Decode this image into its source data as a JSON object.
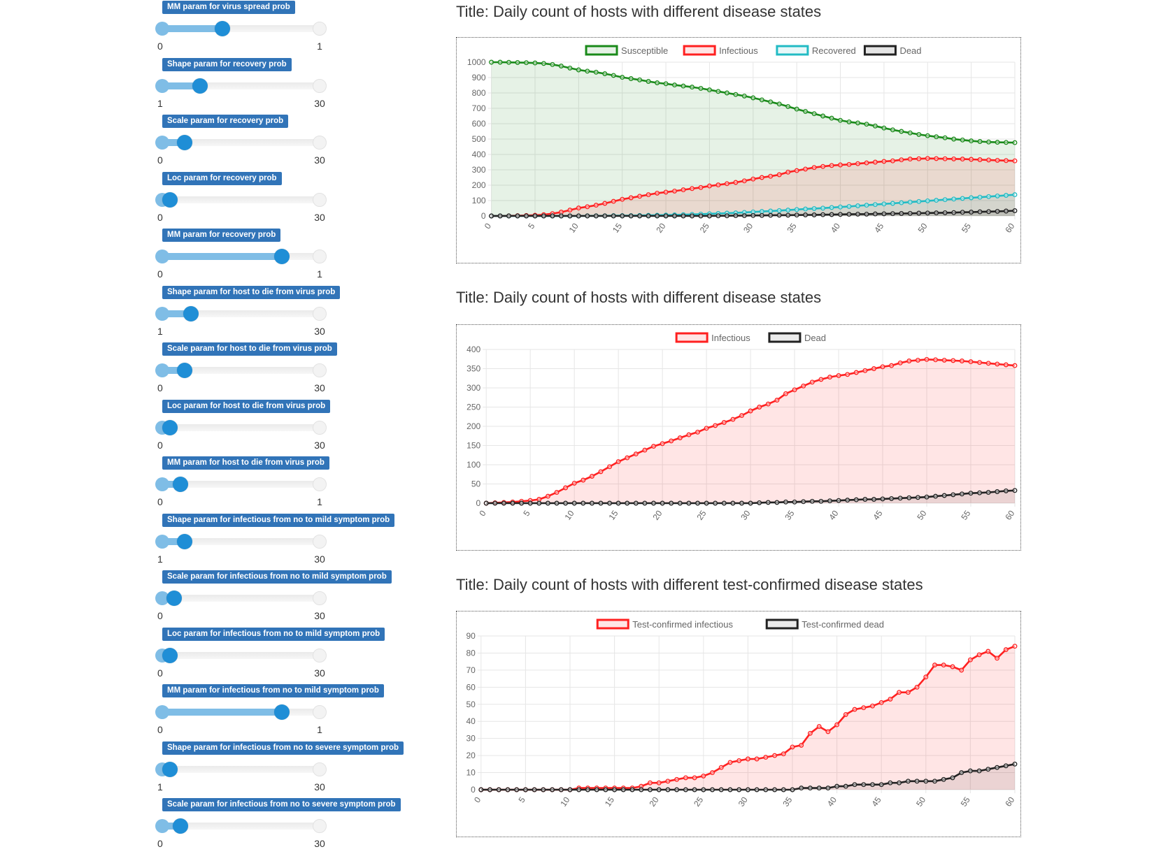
{
  "sliders": [
    {
      "label": "MM param for virus spread prob",
      "min": "0",
      "max": "1",
      "value": 0.35
    },
    {
      "label": "Shape param for recovery prob",
      "min": "1",
      "max": "30",
      "value": 0.2
    },
    {
      "label": "Scale param for recovery prob",
      "min": "0",
      "max": "30",
      "value": 0.1
    },
    {
      "label": "Loc param for recovery prob",
      "min": "0",
      "max": "30",
      "value": 0.0
    },
    {
      "label": "MM param for recovery prob",
      "min": "0",
      "max": "1",
      "value": 0.75
    },
    {
      "label": "Shape param for host to die from virus prob",
      "min": "1",
      "max": "30",
      "value": 0.14
    },
    {
      "label": "Scale param for host to die from virus prob",
      "min": "0",
      "max": "30",
      "value": 0.1
    },
    {
      "label": "Loc param for host to die from virus prob",
      "min": "0",
      "max": "30",
      "value": 0.0
    },
    {
      "label": "MM param for host to die from virus prob",
      "min": "0",
      "max": "1",
      "value": 0.07
    },
    {
      "label": "Shape param for infectious from no to mild symptom prob",
      "min": "1",
      "max": "30",
      "value": 0.1
    },
    {
      "label": "Scale param for infectious from no to mild symptom prob",
      "min": "0",
      "max": "30",
      "value": 0.03
    },
    {
      "label": "Loc param for infectious from no to mild symptom prob",
      "min": "0",
      "max": "30",
      "value": 0.0
    },
    {
      "label": "MM param for infectious from no to mild symptom prob",
      "min": "0",
      "max": "1",
      "value": 0.75
    },
    {
      "label": "Shape param for infectious from no to severe symptom prob",
      "min": "1",
      "max": "30",
      "value": 0.0
    },
    {
      "label": "Scale param for infectious from no to severe symptom prob",
      "min": "0",
      "max": "30",
      "value": 0.07
    }
  ],
  "colors": {
    "accent": "#1f8ed6",
    "label_bg": "#3174b8",
    "green": "#1a8a1a",
    "red": "#ff2020",
    "cyan": "#22bbc4",
    "black": "#222222"
  },
  "chart_data": [
    {
      "type": "area",
      "title": "Title: Daily count of hosts with different disease states",
      "x": [
        0,
        1,
        2,
        3,
        4,
        5,
        6,
        7,
        8,
        9,
        10,
        11,
        12,
        13,
        14,
        15,
        16,
        17,
        18,
        19,
        20,
        21,
        22,
        23,
        24,
        25,
        26,
        27,
        28,
        29,
        30,
        31,
        32,
        33,
        34,
        35,
        36,
        37,
        38,
        39,
        40,
        41,
        42,
        43,
        44,
        45,
        46,
        47,
        48,
        49,
        50,
        51,
        52,
        53,
        54,
        55,
        56,
        57,
        58,
        59,
        60
      ],
      "xticks": [
        0,
        5,
        10,
        15,
        20,
        25,
        30,
        35,
        40,
        45,
        50,
        55,
        60
      ],
      "ylim": [
        0,
        1000
      ],
      "yticks": [
        0,
        100,
        200,
        300,
        400,
        500,
        600,
        700,
        800,
        900,
        1000
      ],
      "legend_position": "top-center",
      "series": [
        {
          "name": "Susceptible",
          "color": "#1a8a1a",
          "fill": "rgba(26,138,26,0.11)",
          "values": [
            1000,
            1000,
            999,
            998,
            997,
            995,
            992,
            985,
            975,
            962,
            950,
            942,
            935,
            925,
            914,
            902,
            893,
            885,
            875,
            866,
            860,
            852,
            845,
            838,
            830,
            820,
            810,
            800,
            790,
            780,
            768,
            755,
            742,
            728,
            712,
            695,
            680,
            665,
            650,
            636,
            622,
            612,
            605,
            597,
            585,
            572,
            560,
            550,
            540,
            530,
            522,
            515,
            508,
            500,
            494,
            488,
            484,
            481,
            479,
            478,
            477
          ]
        },
        {
          "name": "Infectious",
          "color": "#ff2020",
          "fill": "rgba(255,40,40,0.12)",
          "values": [
            0,
            0,
            1,
            2,
            3,
            5,
            8,
            15,
            25,
            38,
            52,
            60,
            70,
            82,
            95,
            108,
            118,
            128,
            138,
            148,
            155,
            162,
            170,
            178,
            185,
            195,
            202,
            210,
            218,
            228,
            240,
            250,
            258,
            268,
            285,
            295,
            305,
            315,
            322,
            328,
            332,
            335,
            340,
            345,
            350,
            355,
            358,
            365,
            370,
            372,
            374,
            373,
            372,
            371,
            370,
            368,
            366,
            364,
            362,
            360,
            358
          ]
        },
        {
          "name": "Recovered",
          "color": "#22bbc4",
          "fill": "rgba(34,187,196,0.10)",
          "values": [
            0,
            0,
            0,
            0,
            0,
            0,
            0,
            0,
            0,
            0,
            0,
            1,
            1,
            1,
            2,
            2,
            2,
            3,
            4,
            5,
            6,
            7,
            8,
            10,
            12,
            14,
            16,
            18,
            20,
            23,
            26,
            29,
            32,
            35,
            38,
            42,
            45,
            48,
            51,
            55,
            58,
            62,
            66,
            70,
            74,
            78,
            82,
            86,
            90,
            94,
            98,
            102,
            106,
            110,
            114,
            118,
            122,
            126,
            130,
            134,
            138
          ]
        },
        {
          "name": "Dead",
          "color": "#222222",
          "fill": "rgba(0,0,0,0.10)",
          "values": [
            0,
            0,
            0,
            0,
            0,
            0,
            0,
            0,
            0,
            0,
            0,
            0,
            0,
            0,
            0,
            0,
            0,
            0,
            0,
            0,
            0,
            0,
            0,
            0,
            0,
            0,
            1,
            1,
            2,
            2,
            3,
            3,
            4,
            5,
            5,
            6,
            7,
            7,
            8,
            9,
            10,
            11,
            12,
            12,
            13,
            14,
            15,
            16,
            17,
            18,
            19,
            20,
            21,
            22,
            24,
            25,
            27,
            28,
            30,
            32,
            34
          ]
        }
      ]
    },
    {
      "type": "area",
      "title": "Title: Daily count of hosts with different disease states",
      "x": [
        0,
        1,
        2,
        3,
        4,
        5,
        6,
        7,
        8,
        9,
        10,
        11,
        12,
        13,
        14,
        15,
        16,
        17,
        18,
        19,
        20,
        21,
        22,
        23,
        24,
        25,
        26,
        27,
        28,
        29,
        30,
        31,
        32,
        33,
        34,
        35,
        36,
        37,
        38,
        39,
        40,
        41,
        42,
        43,
        44,
        45,
        46,
        47,
        48,
        49,
        50,
        51,
        52,
        53,
        54,
        55,
        56,
        57,
        58,
        59,
        60
      ],
      "xticks": [
        0,
        5,
        10,
        15,
        20,
        25,
        30,
        35,
        40,
        45,
        50,
        55,
        60
      ],
      "ylim": [
        0,
        400
      ],
      "yticks": [
        0,
        50,
        100,
        150,
        200,
        250,
        300,
        350,
        400
      ],
      "legend_position": "top-center",
      "series": [
        {
          "name": "Infectious",
          "color": "#ff2020",
          "fill": "rgba(255,40,40,0.12)",
          "values": [
            0,
            1,
            2,
            3,
            5,
            7,
            10,
            18,
            28,
            40,
            52,
            60,
            70,
            82,
            95,
            108,
            118,
            128,
            138,
            148,
            155,
            162,
            170,
            178,
            185,
            195,
            202,
            210,
            218,
            228,
            240,
            250,
            258,
            268,
            285,
            295,
            305,
            315,
            322,
            328,
            332,
            335,
            340,
            345,
            350,
            355,
            358,
            365,
            370,
            372,
            374,
            373,
            372,
            371,
            370,
            368,
            366,
            364,
            362,
            360,
            358
          ]
        },
        {
          "name": "Dead",
          "color": "#222222",
          "fill": "rgba(0,0,0,0.08)",
          "values": [
            0,
            0,
            0,
            0,
            0,
            0,
            0,
            0,
            0,
            0,
            0,
            0,
            0,
            0,
            0,
            0,
            0,
            0,
            0,
            0,
            0,
            0,
            0,
            0,
            0,
            0,
            0,
            0,
            0,
            0,
            0,
            1,
            2,
            2,
            3,
            3,
            4,
            5,
            5,
            6,
            7,
            8,
            9,
            10,
            10,
            11,
            12,
            13,
            14,
            15,
            16,
            18,
            20,
            22,
            24,
            26,
            27,
            28,
            30,
            32,
            33
          ]
        }
      ]
    },
    {
      "type": "area",
      "title": "Title: Daily count of hosts with different test-confirmed disease states",
      "x": [
        0,
        1,
        2,
        3,
        4,
        5,
        6,
        7,
        8,
        9,
        10,
        11,
        12,
        13,
        14,
        15,
        16,
        17,
        18,
        19,
        20,
        21,
        22,
        23,
        24,
        25,
        26,
        27,
        28,
        29,
        30,
        31,
        32,
        33,
        34,
        35,
        36,
        37,
        38,
        39,
        40,
        41,
        42,
        43,
        44,
        45,
        46,
        47,
        48,
        49,
        50,
        51,
        52,
        53,
        54,
        55,
        56,
        57,
        58,
        59,
        60
      ],
      "xticks": [
        0,
        5,
        10,
        15,
        20,
        25,
        30,
        35,
        40,
        45,
        50,
        55,
        60
      ],
      "ylim": [
        0,
        90
      ],
      "yticks": [
        0,
        10,
        20,
        30,
        40,
        50,
        60,
        70,
        80,
        90
      ],
      "legend_position": "top-center",
      "series": [
        {
          "name": "Test-confirmed infectious",
          "color": "#ff2020",
          "fill": "rgba(255,40,40,0.12)",
          "values": [
            0,
            0,
            0,
            0,
            0,
            0,
            0,
            0,
            0,
            0,
            0,
            1,
            1,
            1,
            1,
            1,
            1,
            1,
            2,
            4,
            4,
            5,
            6,
            7,
            7,
            8,
            10,
            13,
            16,
            17,
            18,
            18,
            19,
            20,
            21,
            25,
            26,
            33,
            37,
            34,
            38,
            44,
            47,
            48,
            49,
            51,
            53,
            57,
            57,
            60,
            66,
            73,
            73,
            72,
            70,
            76,
            79,
            81,
            77,
            82,
            84
          ]
        },
        {
          "name": "Test-confirmed dead",
          "color": "#222222",
          "fill": "rgba(0,0,0,0.08)",
          "values": [
            0,
            0,
            0,
            0,
            0,
            0,
            0,
            0,
            0,
            0,
            0,
            0,
            0,
            0,
            0,
            0,
            0,
            0,
            0,
            0,
            0,
            0,
            0,
            0,
            0,
            0,
            0,
            0,
            0,
            0,
            0,
            0,
            0,
            0,
            0,
            0,
            1,
            1,
            1,
            1,
            2,
            2,
            3,
            3,
            3,
            3,
            4,
            4,
            5,
            5,
            5,
            5,
            6,
            7,
            10,
            11,
            11,
            12,
            13,
            14,
            15
          ]
        }
      ]
    }
  ]
}
